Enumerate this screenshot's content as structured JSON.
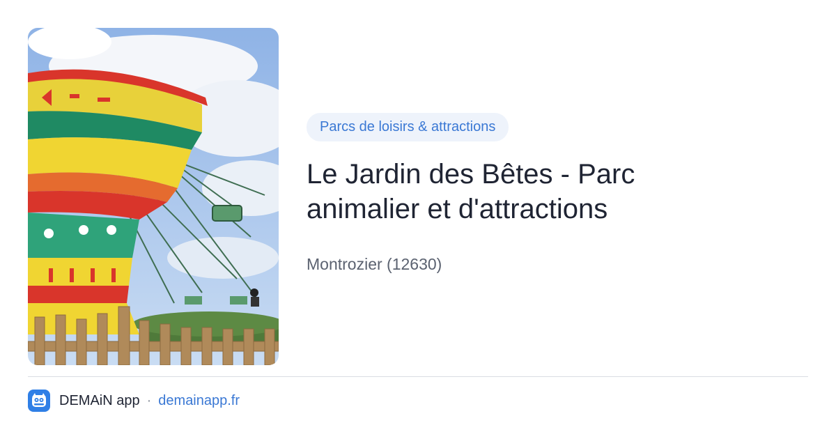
{
  "card": {
    "image_alt": "Chaise volante colorée sous un ciel bleu",
    "category": "Parcs de loisirs & attractions",
    "title": "Le Jardin des Bêtes - Parc animalier et d'attractions",
    "location": "Montrozier (12630)"
  },
  "footer": {
    "app_name": "DEMAiN app",
    "separator": "·",
    "domain": "demainapp.fr",
    "logo_icon": "owl-face-icon"
  },
  "colors": {
    "accent": "#3a78d4",
    "badge_bg": "#eef3fb",
    "title": "#1f2433",
    "muted": "#5b6270",
    "logo_bg": "#2f7fe6"
  }
}
